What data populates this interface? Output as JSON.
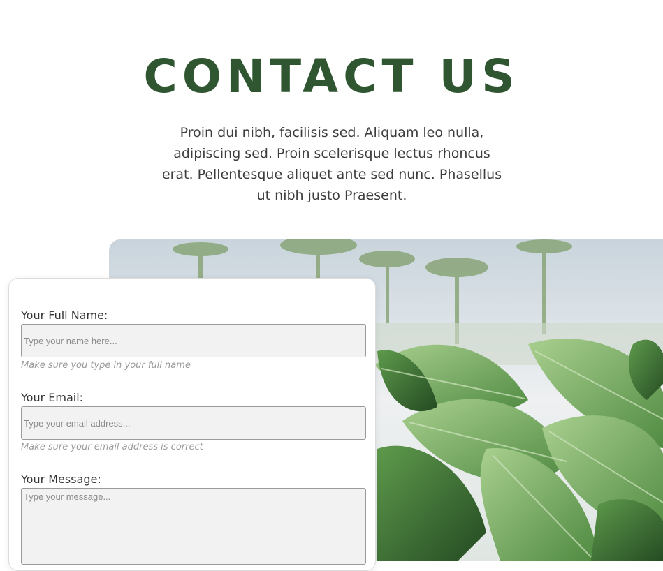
{
  "header": {
    "title": "CONTACT US",
    "intro": "Proin dui nibh, facilisis sed. Aliquam leo nulla, adipiscing sed. Proin scelerisque lectus rhoncus erat. Pellentesque aliquet ante sed nunc. Phasellus ut nibh justo Praesent."
  },
  "form": {
    "name": {
      "label": "Your Full Name:",
      "placeholder": "Type your name here...",
      "hint": "Make sure you type in your full name"
    },
    "email": {
      "label": "Your Email:",
      "placeholder": "Type your email address...",
      "hint": "Make sure your email address is correct"
    },
    "message": {
      "label": "Your Message:",
      "placeholder": "Type your message..."
    }
  },
  "colors": {
    "title": "#2f5631",
    "leaf": "#6fa65a",
    "sky": "#e9ecef"
  }
}
